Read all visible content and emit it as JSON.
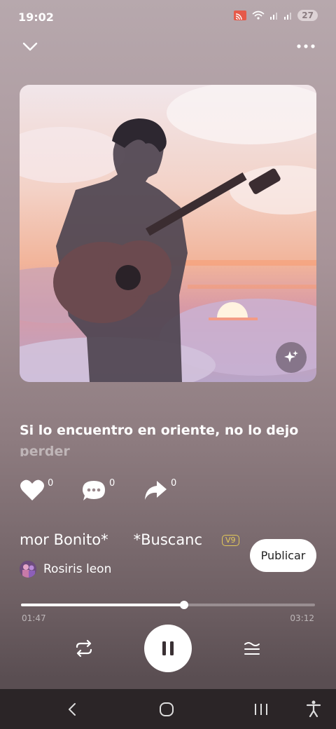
{
  "status_bar": {
    "time": "19:02",
    "battery": "27"
  },
  "icons": {
    "collapse": "chevron-down-icon",
    "more": "more-horizontal-icon",
    "magic": "sparkle-icon",
    "like": "heart-icon",
    "comment": "comment-icon",
    "share": "share-icon",
    "repeat": "repeat-icon",
    "pause": "pause-icon",
    "playlist": "playlist-icon"
  },
  "lyrics": {
    "current": "Si lo encuentro en oriente, no lo dejo",
    "next": "perder"
  },
  "actions": {
    "likes": "0",
    "comments": "0",
    "shares": "0"
  },
  "song": {
    "title_part1": "mor Bonito*",
    "title_part2": "*Buscanc",
    "badge": "V9",
    "artist": "Rosiris leon"
  },
  "publish_label": "Publicar",
  "playback": {
    "elapsed": "01:47",
    "total": "03:12",
    "progress": 0.555
  },
  "colors": {
    "background_top": "#b7a8ad",
    "background_bottom": "#5a4e52",
    "badge": "#e3c95a",
    "nav_bar": "#2b2527"
  }
}
